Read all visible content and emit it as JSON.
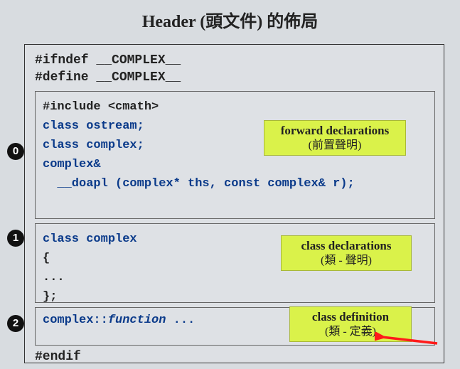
{
  "title": "Header (頭文件) 的佈局",
  "guards": {
    "ifndef": "#ifndef __COMPLEX__",
    "define": "#define __COMPLEX__",
    "endif": "#endif"
  },
  "sections": [
    {
      "badge": "0",
      "code": [
        "#include <cmath>",
        "",
        "class ostream;",
        "class complex;",
        "",
        "complex&",
        "  __doapl (complex* ths, const complex& r);"
      ],
      "label": {
        "en": "forward declarations",
        "zh": "(前置聲明)"
      },
      "include_color": "black"
    },
    {
      "badge": "1",
      "code": [
        "class complex",
        "{",
        "...",
        "};"
      ],
      "label": {
        "en": "class declarations",
        "zh": "(類 - 聲明)"
      }
    },
    {
      "badge": "2",
      "code": [
        "complex::function ..."
      ],
      "label": {
        "en": "class definition",
        "zh": "(類 - 定義)"
      },
      "italic_part": "function"
    }
  ]
}
